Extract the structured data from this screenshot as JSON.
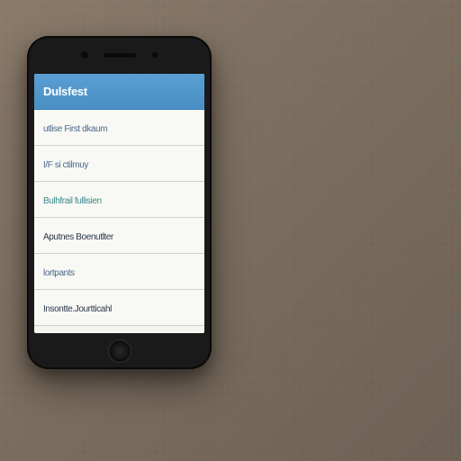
{
  "app": {
    "title": "Dulsfest"
  },
  "list": {
    "items": [
      {
        "label": "utlise First dkaum",
        "tone": "blue"
      },
      {
        "label": "I/F si ctilmuy",
        "tone": "blue"
      },
      {
        "label": "Bulhfrail fullisien",
        "tone": "teal"
      },
      {
        "label": "Aputnes Boenutlter",
        "tone": "dark"
      },
      {
        "label": "lortpants",
        "tone": "blue"
      },
      {
        "label": "Insontte.Jourtticahl",
        "tone": "dark"
      }
    ]
  }
}
